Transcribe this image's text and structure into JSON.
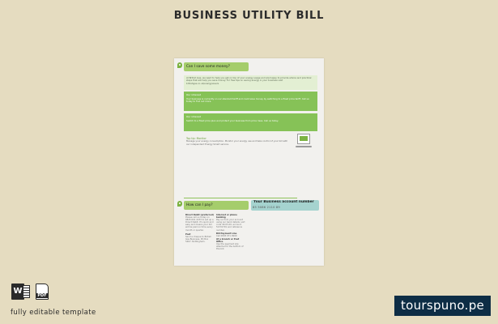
{
  "page_title": "BUSINESS UTILITY BILL",
  "document": {
    "section_save": {
      "heading": "Can I save some money?",
      "intro": "At British Gas, we want to help you get on top of your energy usage and are happy to provide advice and practical steps that will help you save money. For free tips on saving energy in your business visit britishgas.co.uk/energysavers",
      "box1": {
        "heading": "Our interest",
        "text": "Your business is currently on our standard tariff and could save money by switching to a fixed price tariff. Call us today to find out more."
      },
      "box2": {
        "heading": "Our interest",
        "text": "Switch to a fixed price plan and protect your business from price rises. Call us today."
      },
      "tip": {
        "heading": "Top tip: Monitor",
        "text": "Manage your energy consumption. Monitor your energy use and take control of your bill with our independent Energy Smart service."
      }
    },
    "section_pay": {
      "heading": "How can I pay?",
      "account_label": "Your Business account number",
      "account_number": "85 5086 2110 89",
      "left_col": [
        {
          "bold": "Direct Debit (preferred)",
          "text": "Please call us today on 0845 601 2233 to set up a Direct Debit. It's quick and easy and means your bill will be paid on time every month or quarter."
        },
        {
          "bold": "Post",
          "text": "Send a cheque to British Gas Business, PO Box 5467, Nottingham."
        }
      ],
      "right_col": [
        {
          "bold": "Internet or phone banking",
          "text": "Pay us from your account using our bank details: sort code 40-03-20, account 51331701 and reference number."
        },
        {
          "bold": "Bill Payment Line",
          "text": "Call 0845 071 9999"
        },
        {
          "bold": "At a branch or Post Office",
          "text": "Use the payment slip attached to the bottom of this bill."
        }
      ]
    }
  },
  "footer": {
    "word_icon_letter": "W",
    "pdf_icon_label": "PDF",
    "editable_note": "fully editable template",
    "brand": "tourspuno.pe"
  },
  "colors": {
    "background": "#e5dcc0",
    "accent_green": "#86c257",
    "accent_teal": "#a5d3cf",
    "brand_navy": "#0d2d45"
  }
}
